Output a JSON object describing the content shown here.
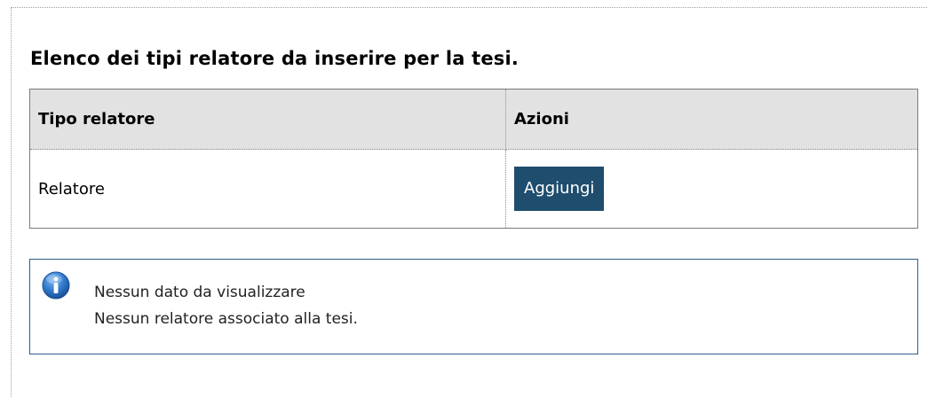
{
  "page": {
    "title": "Elenco dei tipi relatore da inserire per la tesi."
  },
  "table": {
    "headers": [
      "Tipo relatore",
      "Azioni"
    ],
    "rows": [
      {
        "tipo": "Relatore",
        "action_label": "Aggiungi"
      }
    ]
  },
  "message": {
    "icon": "info-icon",
    "line1": "Nessun dato da visualizzare",
    "line2": "Nessun relatore associato alla tesi."
  },
  "colors": {
    "button_bg": "#1f4d6e",
    "header_bg": "#e2e2e2",
    "info_border": "#2d5d8c"
  }
}
